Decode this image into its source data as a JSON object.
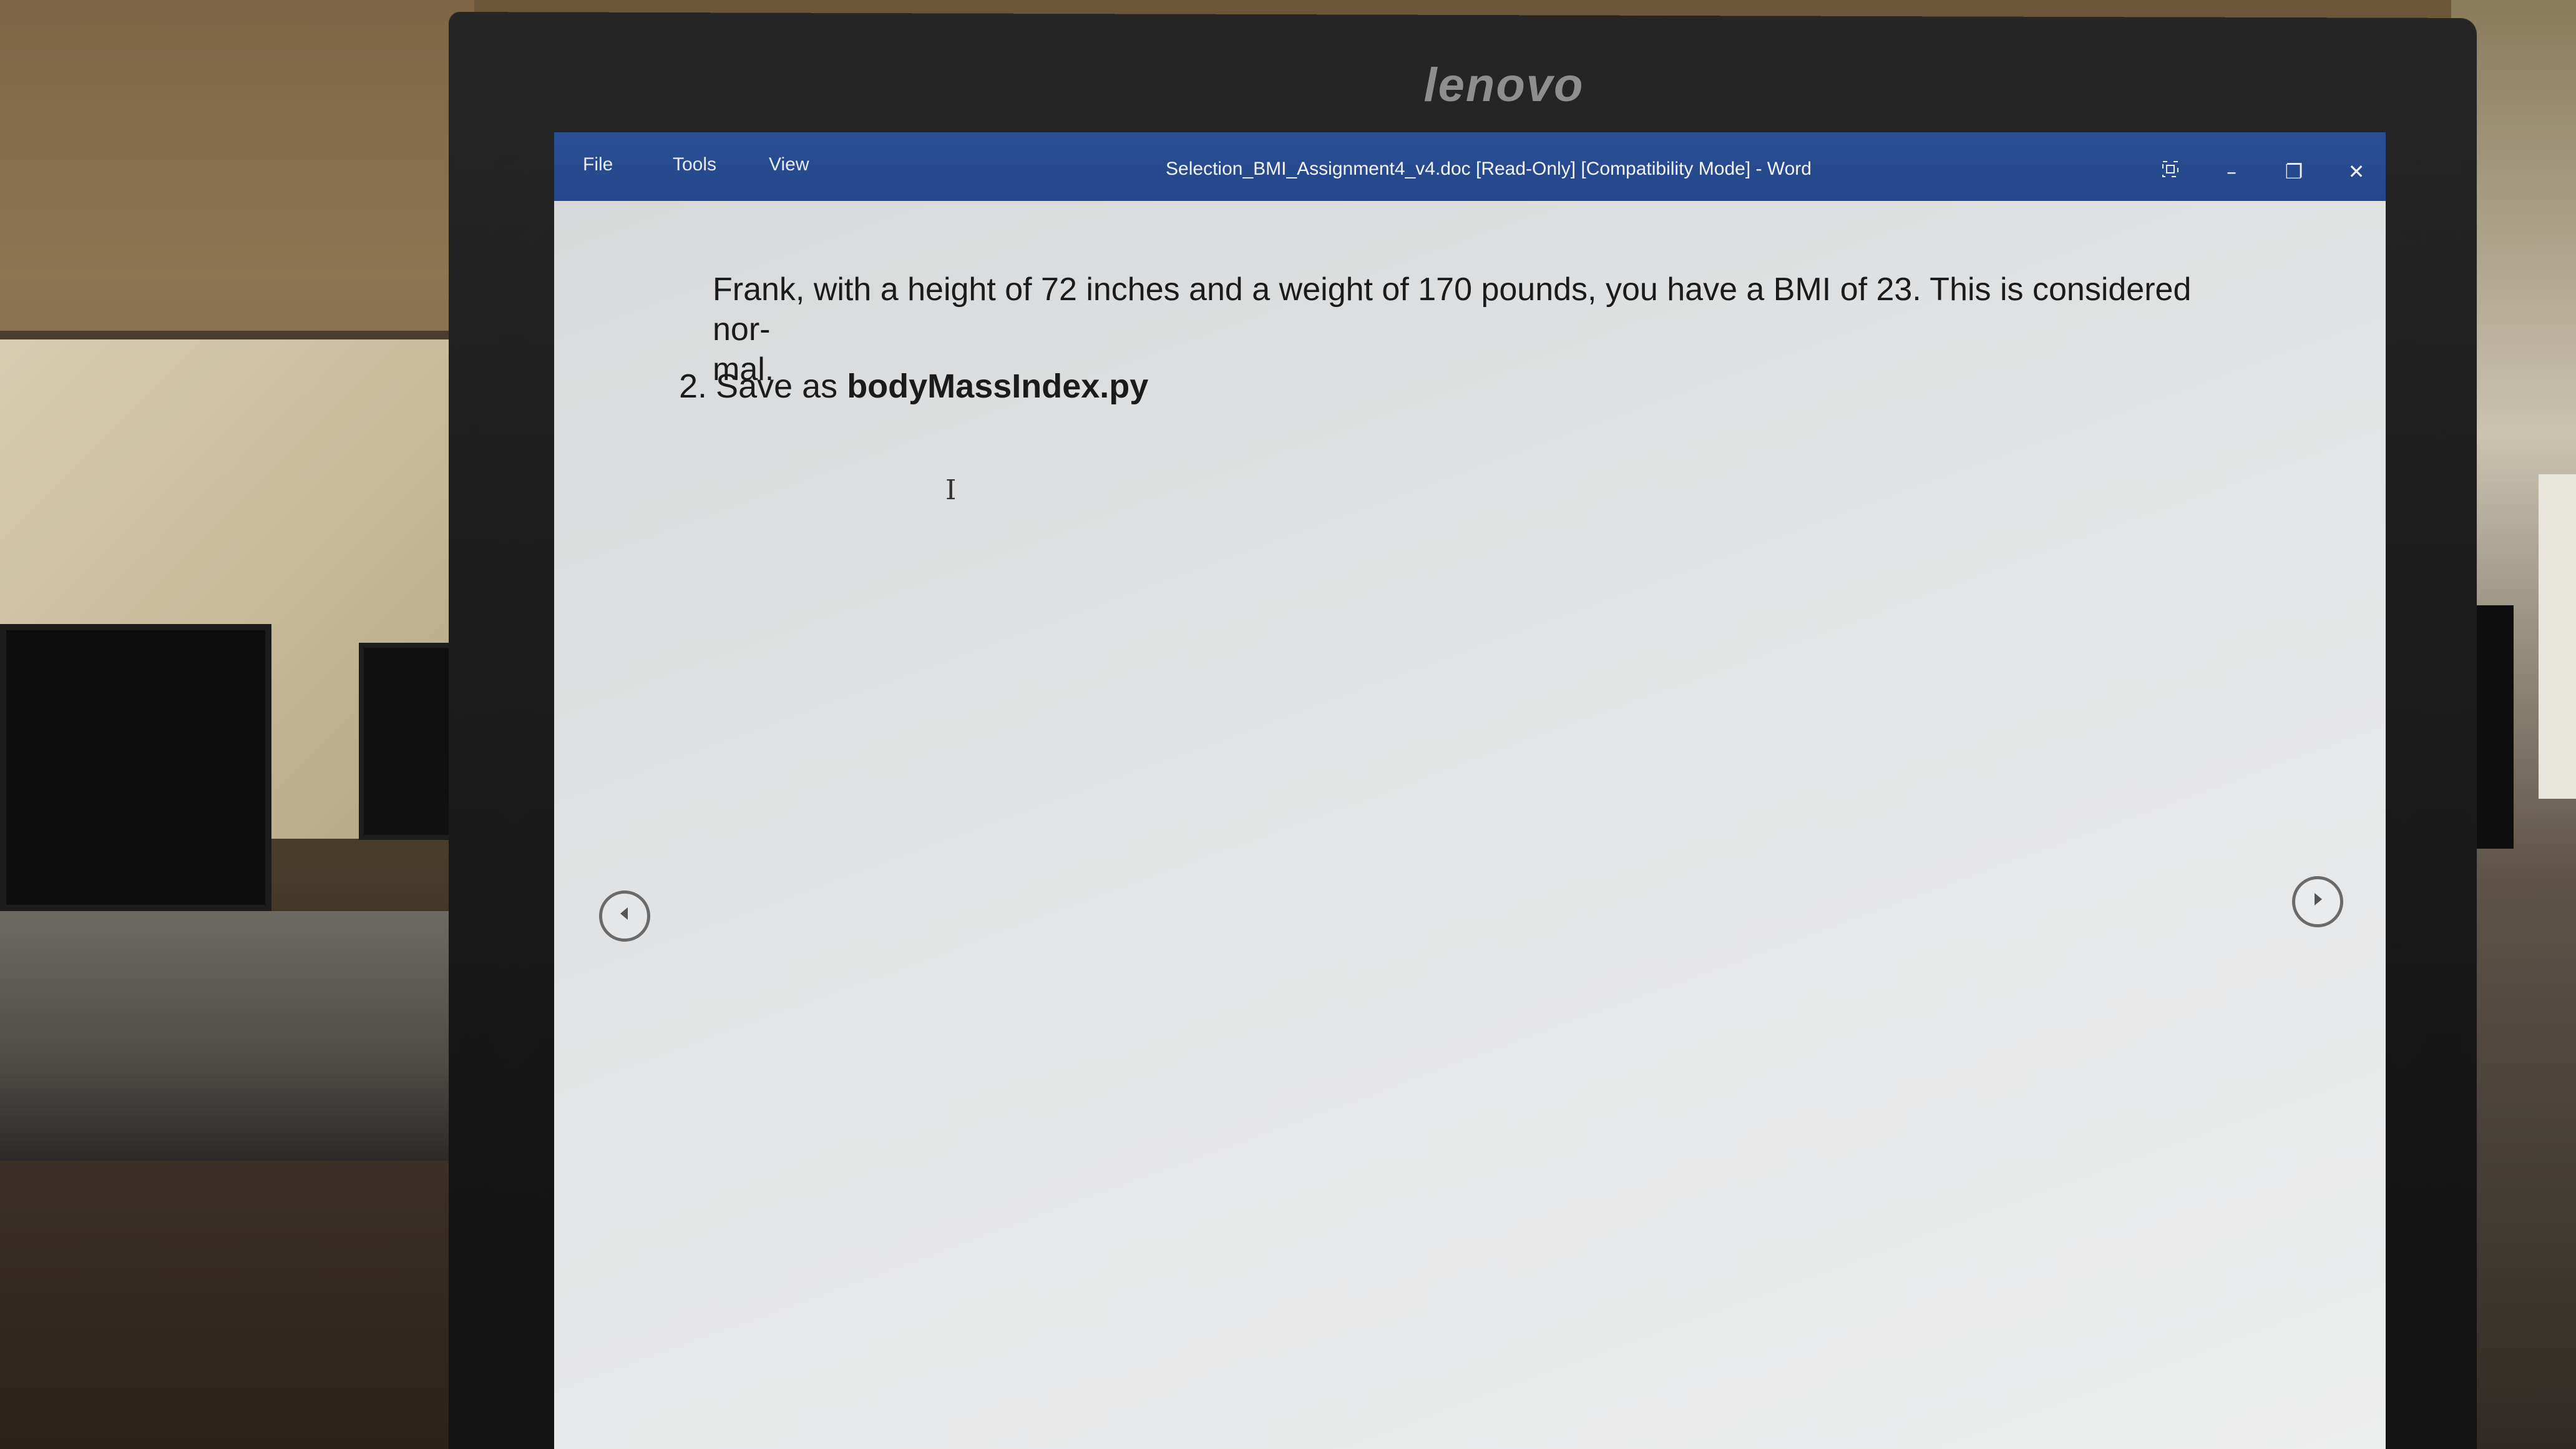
{
  "monitor": {
    "brand": "lenovo"
  },
  "window": {
    "title": "Selection_BMI_Assignment4_v4.doc [Read-Only] [Compatibility Mode] - Word",
    "menu": [
      "File",
      "Tools",
      "View"
    ],
    "controls": {
      "focus_icon": "focus-mode-icon",
      "minimize": "–",
      "restore": "❐",
      "close": "✕"
    },
    "titlebar_color": "#24468a"
  },
  "document": {
    "paragraph_line1": "Frank, with a height of 72 inches and a weight of 170 pounds, you have a BMI of 23.  This is considered nor-",
    "paragraph_line2": "mal.",
    "list_item": {
      "number": "2.",
      "text": "Save as",
      "filename": "bodyMassIndex.py"
    }
  },
  "navigation": {
    "prev_icon": "chevron-left-icon",
    "next_icon": "chevron-right-icon"
  }
}
